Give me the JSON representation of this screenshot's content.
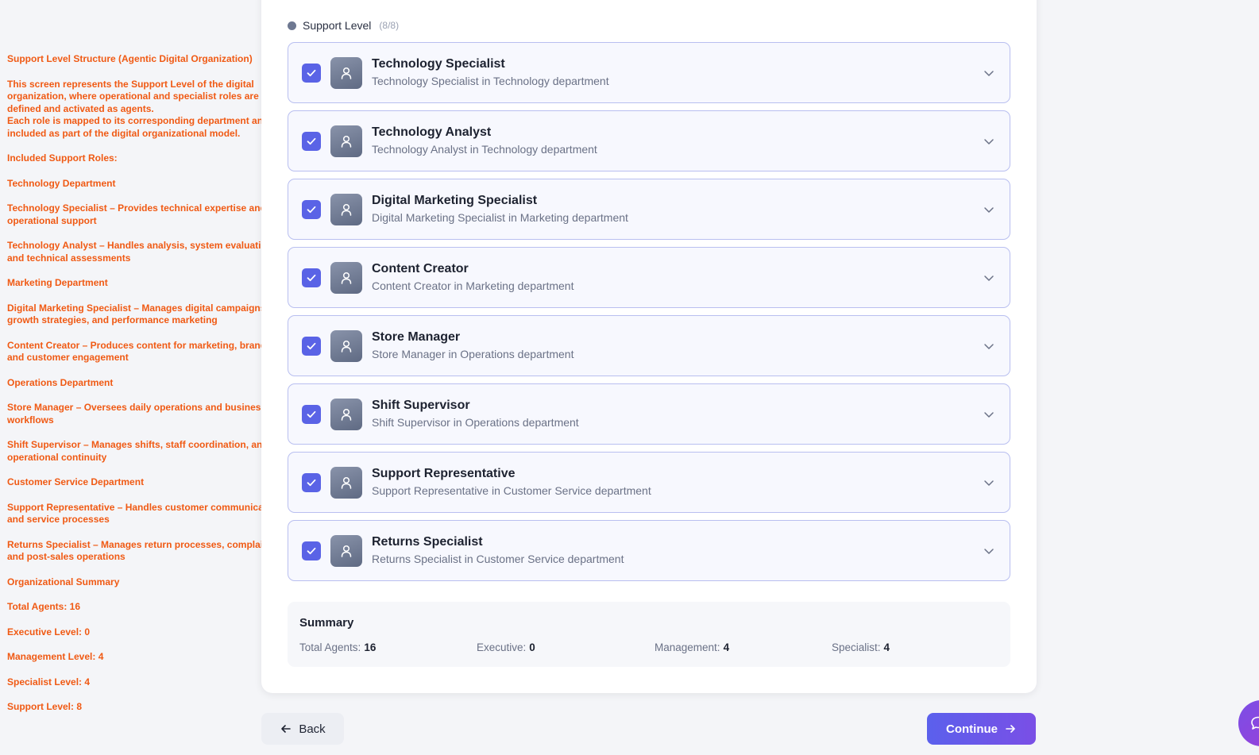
{
  "notes": [
    "Support Level Structure (Agentic Digital Organization)",
    "This screen represents the Support Level of the digital organization, where operational and specialist roles are defined and activated as agents.",
    "Each role is mapped to its corresponding department and included as part of the digital organizational model.",
    "Included Support Roles:",
    "Technology Department",
    "Technology Specialist – Provides technical expertise and operational support",
    "Technology Analyst – Handles analysis, system evaluation, and technical assessments",
    "Marketing Department",
    "Digital Marketing Specialist – Manages digital campaigns, growth strategies, and performance marketing",
    "Content Creator – Produces content for marketing, branding, and customer engagement",
    "Operations Department",
    "Store Manager – Oversees daily operations and business workflows",
    "Shift Supervisor – Manages shifts, staff coordination, and operational continuity",
    "Customer Service Department",
    "Support Representative – Handles customer communication and service processes",
    "Returns Specialist – Manages return processes, complaints, and post-sales operations",
    "Organizational Summary",
    "Total Agents: 16",
    "Executive Level: 0",
    "Management Level: 4",
    "Specialist Level: 4",
    "Support Level: 8"
  ],
  "level": {
    "title": "Support Level",
    "count": "(8/8)"
  },
  "roles": [
    {
      "title": "Technology Specialist",
      "subtitle": "Technology Specialist in Technology department",
      "checked": true
    },
    {
      "title": "Technology Analyst",
      "subtitle": "Technology Analyst in Technology department",
      "checked": true
    },
    {
      "title": "Digital Marketing Specialist",
      "subtitle": "Digital Marketing Specialist in Marketing department",
      "checked": true
    },
    {
      "title": "Content Creator",
      "subtitle": "Content Creator in Marketing department",
      "checked": true
    },
    {
      "title": "Store Manager",
      "subtitle": "Store Manager in Operations department",
      "checked": true
    },
    {
      "title": "Shift Supervisor",
      "subtitle": "Shift Supervisor in Operations department",
      "checked": true
    },
    {
      "title": "Support Representative",
      "subtitle": "Support Representative in Customer Service department",
      "checked": true
    },
    {
      "title": "Returns Specialist",
      "subtitle": "Returns Specialist in Customer Service department",
      "checked": true
    }
  ],
  "summary": {
    "title": "Summary",
    "stats": [
      {
        "label": "Total Agents:",
        "value": "16"
      },
      {
        "label": "Executive:",
        "value": "0"
      },
      {
        "label": "Management:",
        "value": "4"
      },
      {
        "label": "Specialist:",
        "value": "4"
      }
    ]
  },
  "footer": {
    "back_label": "Back",
    "continue_label": "Continue"
  },
  "icons": {
    "level": "status-dot-icon",
    "check": "checkmark-icon",
    "avatar": "user-icon",
    "expand": "chevron-down-icon",
    "back": "arrow-left-icon",
    "continue": "arrow-right-icon",
    "chat": "chat-bubble-icon"
  },
  "colors": {
    "accent": "#5a63e6",
    "annotation": "#f05a14",
    "card_border": "#b9bff0",
    "continue_gradient_start": "#5b60ec",
    "continue_gradient_end": "#7a4fe6"
  }
}
